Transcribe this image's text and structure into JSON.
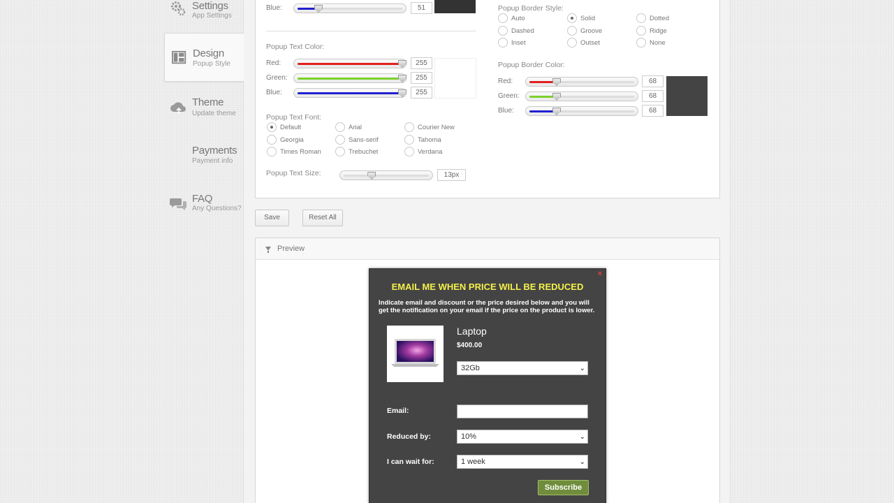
{
  "sidebar": {
    "items": [
      {
        "title": "Settings",
        "subtitle": "App Settings",
        "icon": "gears-icon"
      },
      {
        "title": "Design",
        "subtitle": "Popup Style",
        "icon": "layout-icon",
        "active": true
      },
      {
        "title": "Theme",
        "subtitle": "Update theme",
        "icon": "cloud-upload-icon"
      },
      {
        "title": "Payments",
        "subtitle": "Payment info",
        "icon": "none"
      },
      {
        "title": "FAQ",
        "subtitle": "Any Questions?",
        "icon": "chat-bubbles-icon"
      }
    ]
  },
  "bg_color": {
    "blue_label": "Blue:",
    "blue_value": "51",
    "swatch": "#333333"
  },
  "text_color": {
    "section": "Popup Text Color:",
    "red_label": "Red:",
    "red_value": "255",
    "green_label": "Green:",
    "green_value": "255",
    "blue_label": "Blue:",
    "blue_value": "255",
    "swatch": "#ffffff"
  },
  "text_font": {
    "section": "Popup Text Font:",
    "options": [
      "Default",
      "Arial",
      "Courier New",
      "Georgia",
      "Sans-serif",
      "Tahoma",
      "Times Roman",
      "Trebuchet",
      "Verdana"
    ],
    "selected": "Default"
  },
  "text_size": {
    "section": "Popup Text Size:",
    "value": "13px"
  },
  "border_style": {
    "section": "Popup Border Style:",
    "options": [
      "Auto",
      "Solid",
      "Dotted",
      "Dashed",
      "Groove",
      "Ridge",
      "Inset",
      "Outset",
      "None"
    ],
    "selected": "Solid"
  },
  "border_color": {
    "section": "Popup Border Color:",
    "red_label": "Red:",
    "red_value": "68",
    "green_label": "Green:",
    "green_value": "68",
    "blue_label": "Blue:",
    "blue_value": "68",
    "swatch": "#444444"
  },
  "buttons": {
    "save": "Save",
    "reset": "Reset All"
  },
  "preview": {
    "title": "Preview",
    "popup": {
      "close": "×",
      "heading": "EMAIL ME WHEN PRICE WILL BE REDUCED",
      "description": "Indicate email and discount or the price desired below and you will get the notification on your email if the price on the product is lower.",
      "product_name": "Laptop",
      "price": "$400.00",
      "variant": "32Gb",
      "email_label": "Email:",
      "email_value": "",
      "reduced_label": "Reduced by:",
      "reduced_value": "10%",
      "wait_label": "I can wait for:",
      "wait_value": "1 week",
      "subscribe": "Subscribe"
    }
  },
  "colors": {
    "accent_red": "#e02020",
    "accent_green": "#7bd12a",
    "accent_blue": "#2020d0",
    "title_yellow": "#f4f04a",
    "subscribe_green": "#6f8d3c"
  }
}
